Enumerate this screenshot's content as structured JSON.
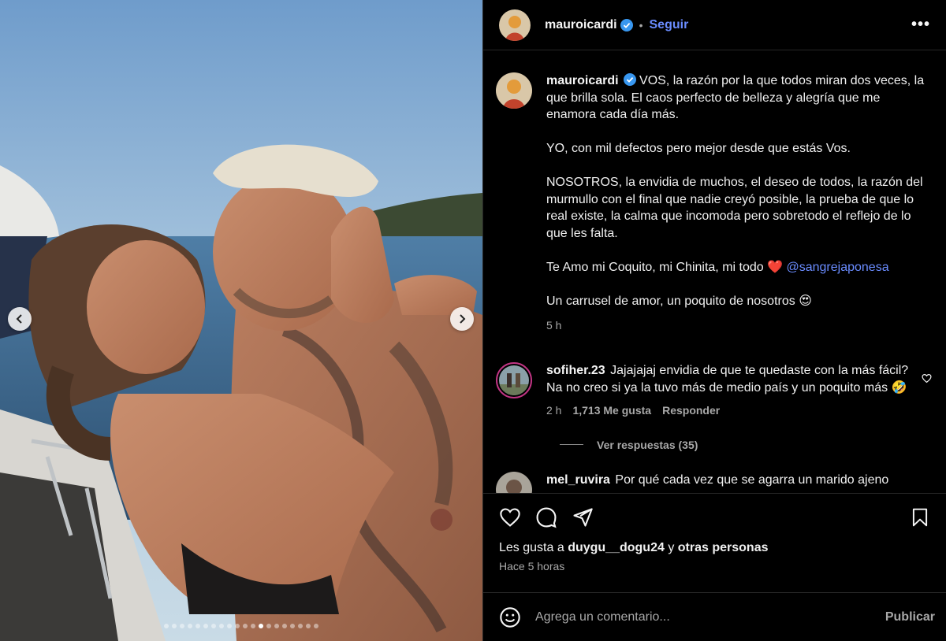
{
  "post": {
    "username": "mauroicardi",
    "follow_label": "Seguir",
    "separator": "•",
    "more_label": "•••",
    "carousel": {
      "total_slides": 20,
      "active_index": 12
    }
  },
  "caption": {
    "username": "mauroicardi",
    "paragraphs": [
      "VOS, la razón por la que todos miran dos veces, la que brilla sola. El caos perfecto de belleza y alegría que me enamora cada día más.",
      "YO, con mil defectos pero mejor desde que estás Vos.",
      "NOSOTROS, la envidia de muchos, el deseo de todos, la razón del murmullo con el final que nadie creyó posible, la prueba de que lo real existe, la calma que incomoda pero sobretodo el reflejo de lo que les falta."
    ],
    "love_text": "Te Amo mi Coquito, mi Chinita, mi todo ❤️",
    "mention": "@sangrejaponesa",
    "last_line": "Un carrusel de amor, un poquito de nosotros 😍",
    "time": "5 h"
  },
  "comments": [
    {
      "username": "sofiher.23",
      "text": "Jajajajaj envidia de que te quedaste con la más fácil? Na no creo si ya la tuvo más de medio país y un poquito más 🤣",
      "time": "2 h",
      "likes": "1,713 Me gusta",
      "reply": "Responder",
      "view_replies": "Ver respuestas (35)"
    },
    {
      "username": "mel_ruvira",
      "text": "Por qué cada vez que se agarra un marido ajeno"
    }
  ],
  "likes": {
    "prefix": "Les gusta a",
    "user": "duygu__dogu24",
    "middle": "y",
    "others": "otras personas"
  },
  "posted_time": "Hace 5 horas",
  "composer": {
    "placeholder": "Agrega un comentario...",
    "publish_label": "Publicar"
  },
  "colors": {
    "background": "#000000",
    "link": "#6a8cff",
    "muted": "#a8a8a8",
    "verified": "#3897f0"
  }
}
